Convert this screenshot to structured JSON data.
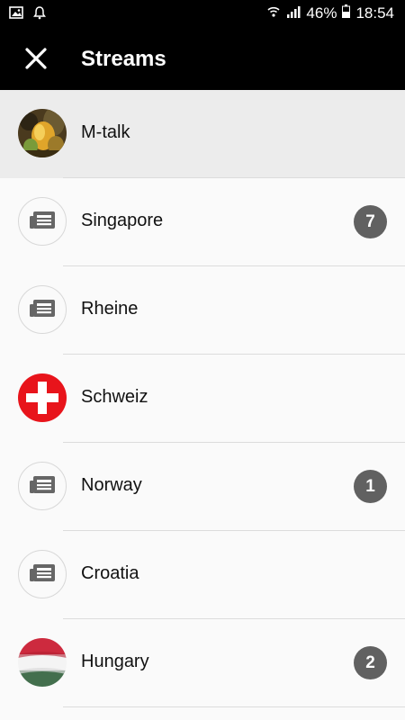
{
  "status_bar": {
    "battery": "46%",
    "time": "18:54",
    "icons": [
      "image-icon",
      "bell-icon",
      "wifi-icon",
      "signal-icon",
      "battery-icon"
    ]
  },
  "app_bar": {
    "title": "Streams",
    "close_icon": "close-icon"
  },
  "streams": [
    {
      "label": "M-talk",
      "avatar": "photo",
      "badge": null,
      "active": true
    },
    {
      "label": "Singapore",
      "avatar": "newspaper-icon",
      "badge": "7",
      "active": false
    },
    {
      "label": "Rheine",
      "avatar": "newspaper-icon",
      "badge": null,
      "active": false
    },
    {
      "label": "Schweiz",
      "avatar": "swiss-flag",
      "badge": null,
      "active": false
    },
    {
      "label": "Norway",
      "avatar": "newspaper-icon",
      "badge": "1",
      "active": false
    },
    {
      "label": "Croatia",
      "avatar": "newspaper-icon",
      "badge": null,
      "active": false
    },
    {
      "label": "Hungary",
      "avatar": "hungarian-flag",
      "badge": "2",
      "active": false
    }
  ],
  "colors": {
    "app_bar": "#000000",
    "active_row": "#ececec",
    "badge": "#616161"
  }
}
